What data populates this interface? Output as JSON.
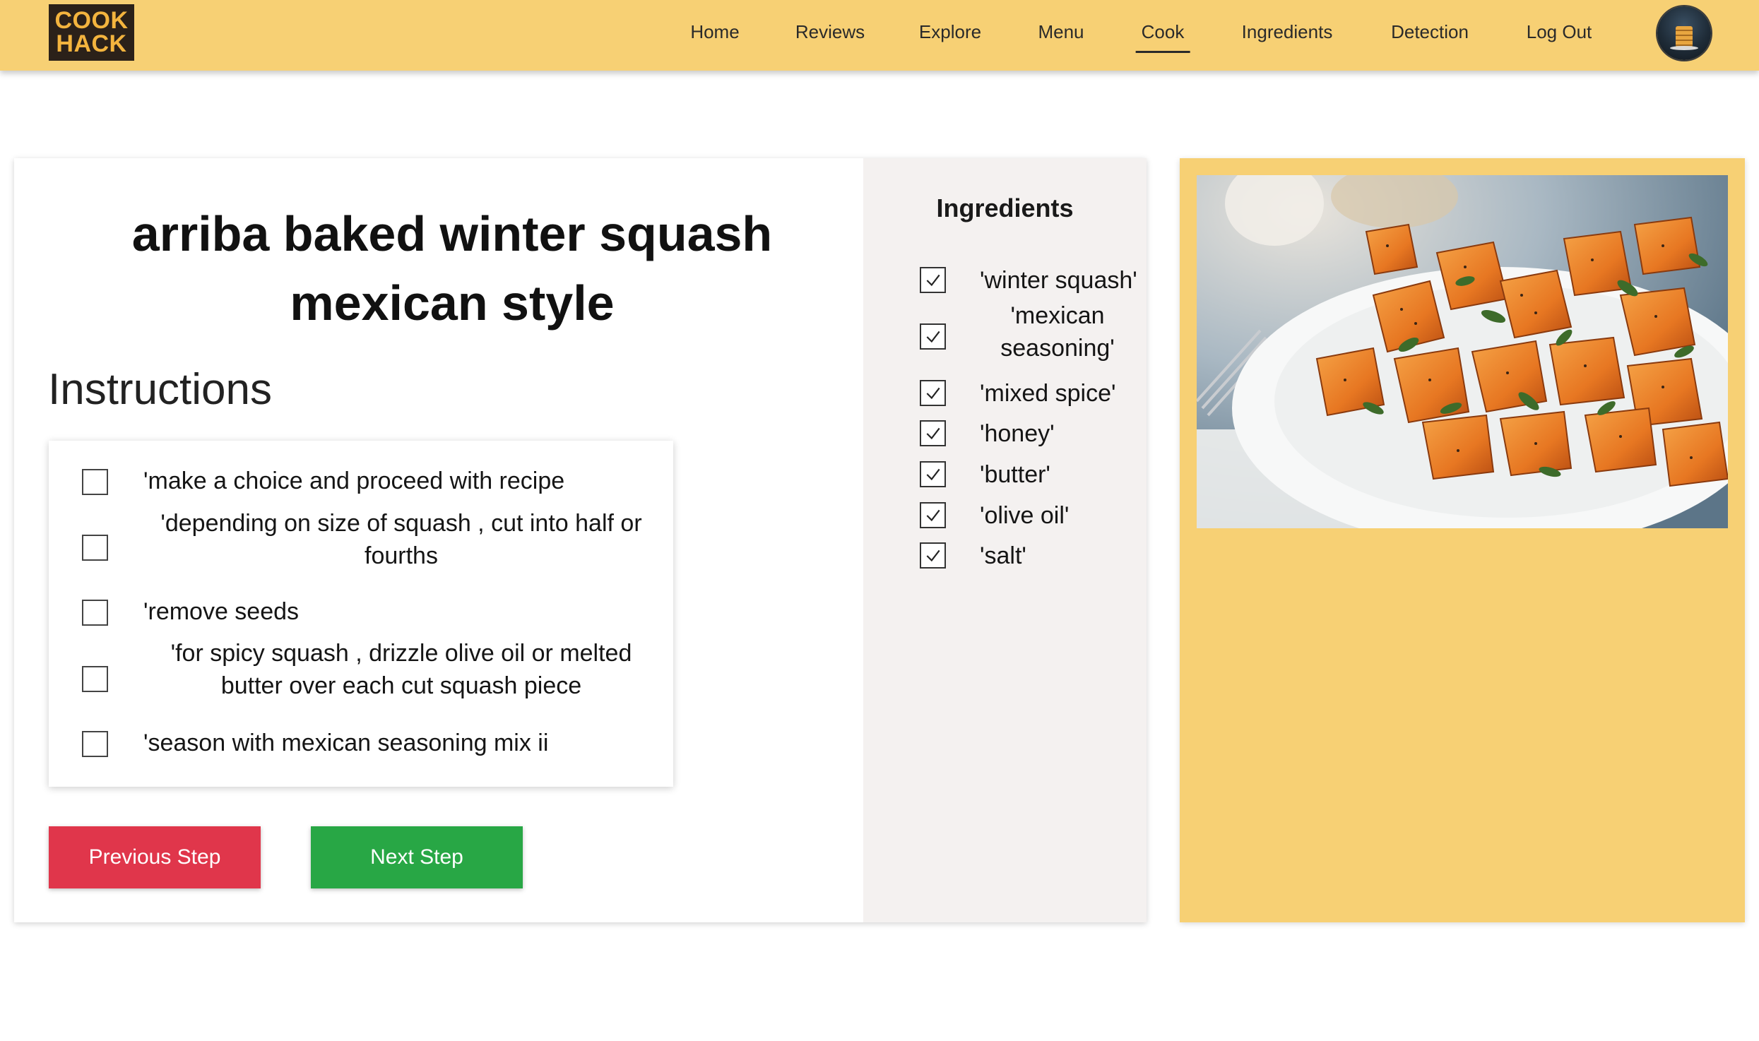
{
  "brand": {
    "logo_line1": "COOK",
    "logo_line2": "HACK"
  },
  "nav": {
    "items": [
      {
        "label": "Home"
      },
      {
        "label": "Reviews"
      },
      {
        "label": "Explore"
      },
      {
        "label": "Menu"
      },
      {
        "label": "Cook",
        "active": true
      },
      {
        "label": "Ingredients"
      },
      {
        "label": "Detection"
      },
      {
        "label": "Log Out"
      }
    ]
  },
  "recipe": {
    "title": "arriba baked winter squash mexican style",
    "instructions_heading": "Instructions",
    "steps": [
      {
        "text": "'make a choice and proceed with recipe",
        "checked": false
      },
      {
        "text": "'depending on size of squash , cut into half or fourths",
        "checked": false
      },
      {
        "text": "'remove seeds",
        "checked": false
      },
      {
        "text": "'for spicy squash , drizzle olive oil or melted butter over each cut squash piece",
        "checked": false
      },
      {
        "text": "'season with mexican seasoning mix ii",
        "checked": false
      }
    ],
    "prev_label": "Previous Step",
    "next_label": "Next Step"
  },
  "ingredients": {
    "heading": "Ingredients",
    "items": [
      {
        "name": "'winter squash'",
        "checked": true
      },
      {
        "name": "'mexican seasoning'",
        "checked": true
      },
      {
        "name": "'mixed spice'",
        "checked": true
      },
      {
        "name": "'honey'",
        "checked": true
      },
      {
        "name": "'butter'",
        "checked": true
      },
      {
        "name": "'olive oil'",
        "checked": true
      },
      {
        "name": "'salt'",
        "checked": true
      }
    ]
  },
  "colors": {
    "navbar": "#f7d074",
    "logo_bg": "#2b2119",
    "logo_text": "#f3b43e",
    "prev_button": "#e0364b",
    "next_button": "#28a745",
    "ingredients_panel": "#f4f1f0"
  },
  "icons": {
    "checked": "check-mark-icon",
    "unchecked": "empty-checkbox-icon"
  }
}
